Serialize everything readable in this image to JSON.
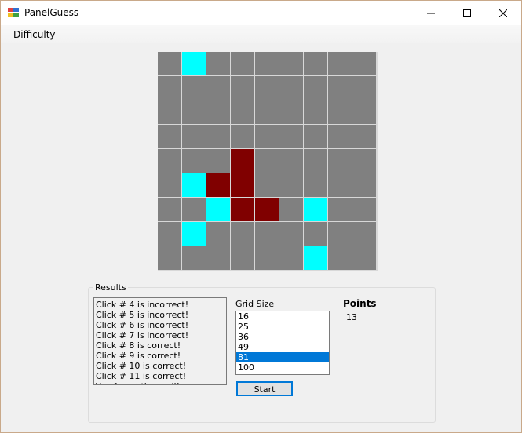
{
  "window": {
    "title": "PanelGuess"
  },
  "menu": {
    "difficulty": "Difficulty"
  },
  "board": {
    "size": 9,
    "legend": {
      "g": "unrevealed",
      "c": "correct-guess",
      "r": "hidden-target"
    },
    "cells": [
      "gcggggggg",
      "ggggggggg",
      "ggggggggg",
      "ggggggggg",
      "gggrggggg",
      "gcrrggggg",
      "ggcrrgcgg",
      "gcggggggg",
      "ggggggcgg"
    ],
    "colors": {
      "unrevealed": "#808080",
      "correct": "#00ffff",
      "hidden": "#800000"
    }
  },
  "results": {
    "label": "Results",
    "log": [
      "Click # 4 is incorrect!",
      "Click # 5 is incorrect!",
      "Click # 6 is incorrect!",
      "Click # 7 is incorrect!",
      "Click # 8 is correct!",
      "Click # 9 is correct!",
      "Click # 10 is correct!",
      "Click # 11 is correct!",
      "You found them all!"
    ],
    "grid_size_label": "Grid Size",
    "grid_size_options": [
      "16",
      "25",
      "36",
      "49",
      "81",
      "100"
    ],
    "grid_size_selected": "81",
    "start_label": "Start",
    "points_label": "Points",
    "points_value": "13"
  },
  "colors": {
    "accent": "#0078d7"
  }
}
